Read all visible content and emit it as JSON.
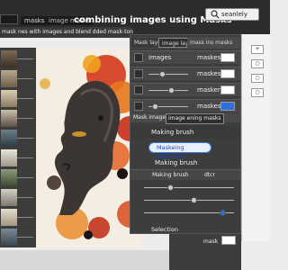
{
  "header": {
    "title": "combining images using Masks",
    "tabs": [
      "masks",
      "image masks"
    ],
    "search_text": "seanlely"
  },
  "subtitle": "mask nes with images and blend dded mask-tongue with masks",
  "panel": {
    "tabs": [
      "Mask layer",
      "image layes",
      "mass ins masks"
    ],
    "rows": [
      {
        "label": "images",
        "right": "maskes",
        "swatch": "#ffffff"
      },
      {
        "label": "",
        "right": "maskes",
        "swatch": "#ffffff"
      },
      {
        "label": "",
        "right": "masken",
        "swatch": "#ffffff"
      },
      {
        "label": "",
        "right": "maskes",
        "swatch": "#2f6fe0"
      }
    ],
    "section": [
      "Mask image",
      "image ening masks"
    ],
    "making_brush": "Making brush",
    "masking_button": "Maskeing selection...",
    "making_brush_2": "Making brush",
    "brush_row": "Making brush",
    "brush_value": "dtcr",
    "selection": "Selection"
  },
  "bottom": {
    "mask_label": "mask"
  },
  "colors": {
    "accent": "#2f6fe0",
    "panel_bg": "#3d3d3d",
    "topbar_bg": "#2c2c2c"
  }
}
